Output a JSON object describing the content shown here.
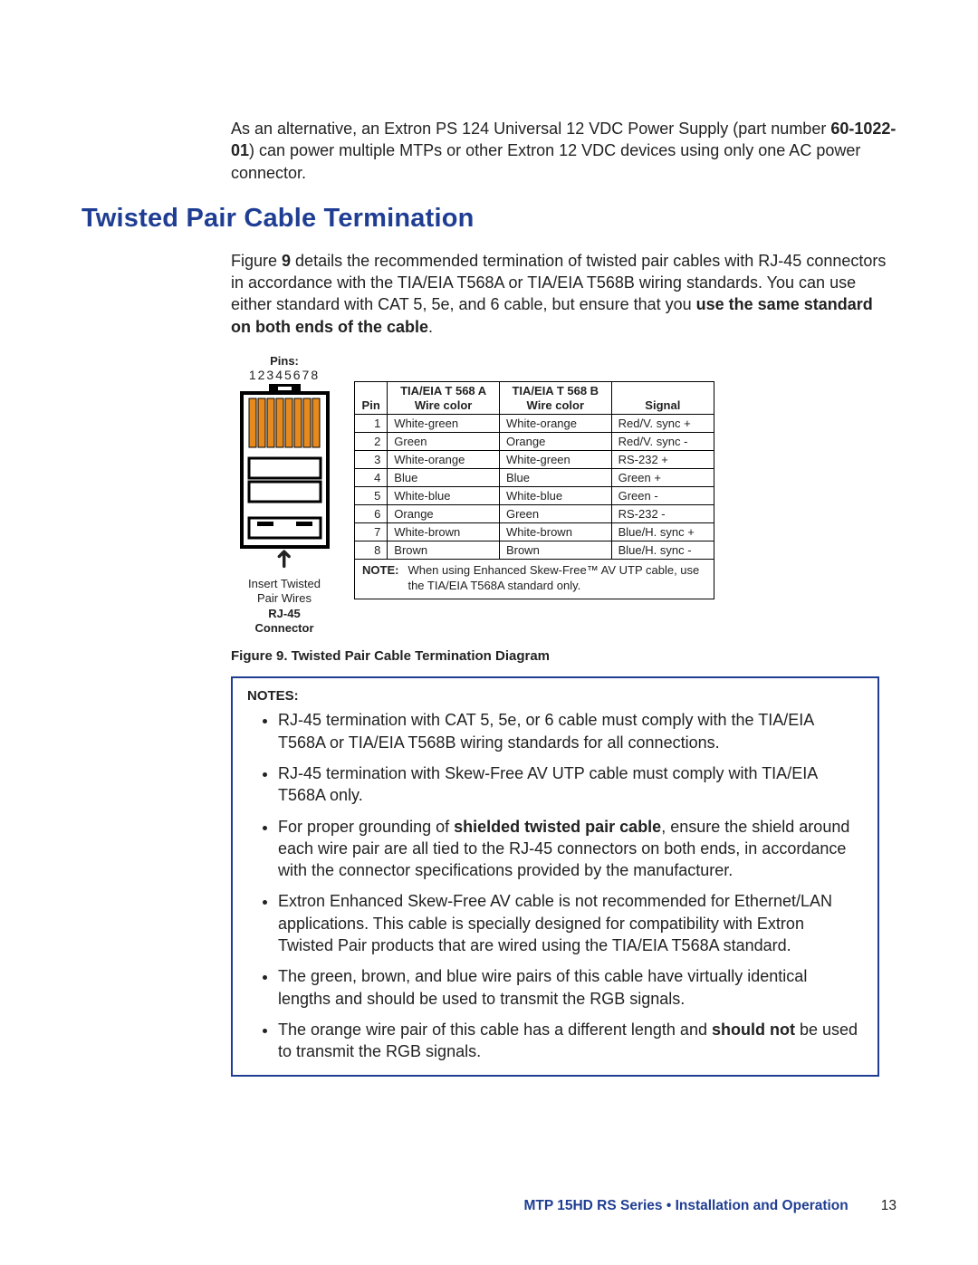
{
  "intro": {
    "p1a": "As an alternative, an Extron PS 124 Universal 12 VDC Power Supply (part number ",
    "part_number": "60-1022-01",
    "p1b": ") can power multiple MTPs or other Extron 12 VDC devices using only one AC power connector."
  },
  "section_heading": "Twisted Pair Cable Termination",
  "section_intro": {
    "a": "Figure ",
    "fig_ref": "9",
    "b": " details the recommended termination of twisted pair cables with RJ-45 connectors in accordance with the TIA/EIA T568A or TIA/EIA T568B wiring standards. You can use either standard with CAT 5, 5e, and 6 cable, but ensure that you ",
    "bold": "use the same standard on both ends of the cable",
    "c": "."
  },
  "rj45": {
    "pins_label": "Pins:",
    "pins_numbers": "12345678",
    "caption_line1": "Insert Twisted",
    "caption_line2": "Pair Wires",
    "caption_line3": "RJ-45",
    "caption_line4": "Connector"
  },
  "table": {
    "head_pin": "Pin",
    "head_a": "TIA/EIA T 568 A\nWire color",
    "head_b": "TIA/EIA T 568 B\nWire color",
    "head_sig": "Signal",
    "rows": [
      {
        "pin": "1",
        "a": "White-green",
        "b": "White-orange",
        "sig": "Red/V. sync +"
      },
      {
        "pin": "2",
        "a": "Green",
        "b": "Orange",
        "sig": "Red/V. sync -"
      },
      {
        "pin": "3",
        "a": "White-orange",
        "b": "White-green",
        "sig": "RS-232 +"
      },
      {
        "pin": "4",
        "a": "Blue",
        "b": "Blue",
        "sig": "Green +"
      },
      {
        "pin": "5",
        "a": "White-blue",
        "b": "White-blue",
        "sig": "Green -"
      },
      {
        "pin": "6",
        "a": "Orange",
        "b": "Green",
        "sig": "RS-232 -"
      },
      {
        "pin": "7",
        "a": "White-brown",
        "b": "White-brown",
        "sig": "Blue/H. sync +"
      },
      {
        "pin": "8",
        "a": "Brown",
        "b": "Brown",
        "sig": "Blue/H. sync -"
      }
    ],
    "note_label": "NOTE:",
    "note_text": "When using Enhanced Skew-Free™ AV UTP cable, use the TIA/EIA T568A standard only."
  },
  "figure_caption": "Figure 9.   Twisted Pair Cable Termination Diagram",
  "notes": {
    "label": "NOTES:",
    "items": [
      {
        "text": "RJ-45 termination with CAT 5, 5e, or 6 cable must comply with the TIA/EIA T568A or TIA/EIA T568B wiring standards for all connections."
      },
      {
        "text": "RJ-45 termination with Skew-Free AV UTP cable must comply with TIA/EIA T568A only."
      },
      {
        "parts": [
          {
            "t": "For proper grounding of "
          },
          {
            "b": "shielded twisted pair cable"
          },
          {
            "t": ", ensure the shield around each wire pair are all tied to the RJ-45 connectors on both ends, in accordance with the connector specifications provided by the manufacturer."
          }
        ]
      },
      {
        "text": "Extron Enhanced Skew-Free AV cable is not recommended for Ethernet/LAN applications. This cable is specially designed for compatibility with Extron Twisted Pair products that are wired using the TIA/EIA T568A standard."
      },
      {
        "text": "The green, brown, and blue wire pairs of this cable have virtually identical lengths and should be used to transmit the RGB signals."
      },
      {
        "parts": [
          {
            "t": "The orange wire pair of this cable has a different length and "
          },
          {
            "b": "should not"
          },
          {
            "t": " be used to transmit the RGB signals."
          }
        ]
      }
    ]
  },
  "footer": {
    "doc_title": "MTP 15HD RS Series • Installation and Operation",
    "page": "13"
  },
  "colors": {
    "brand": "#1f3e93",
    "pin_wire": "#e68a1e"
  }
}
